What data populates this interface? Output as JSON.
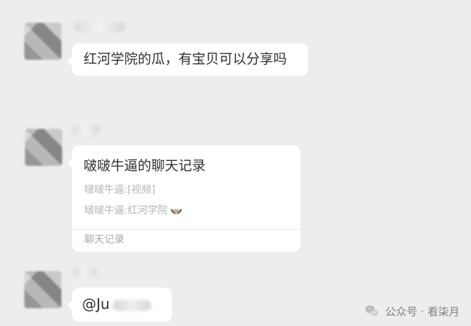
{
  "messages": [
    {
      "text": "红河学院的瓜，有宝贝可以分享吗"
    },
    {
      "title": "啵啵牛逼的聊天记录",
      "preview_lines": [
        "啵啵牛逼:[视频]",
        "啵啵牛逼:红河学院"
      ],
      "footer": "聊天记录"
    },
    {
      "mention_prefix": "@Ju"
    }
  ],
  "watermark": {
    "text": "公众号 · 看柒月"
  },
  "icons": {
    "watermark_icon": "wechat-icon",
    "preview_emoji": "watermelon-icon"
  }
}
